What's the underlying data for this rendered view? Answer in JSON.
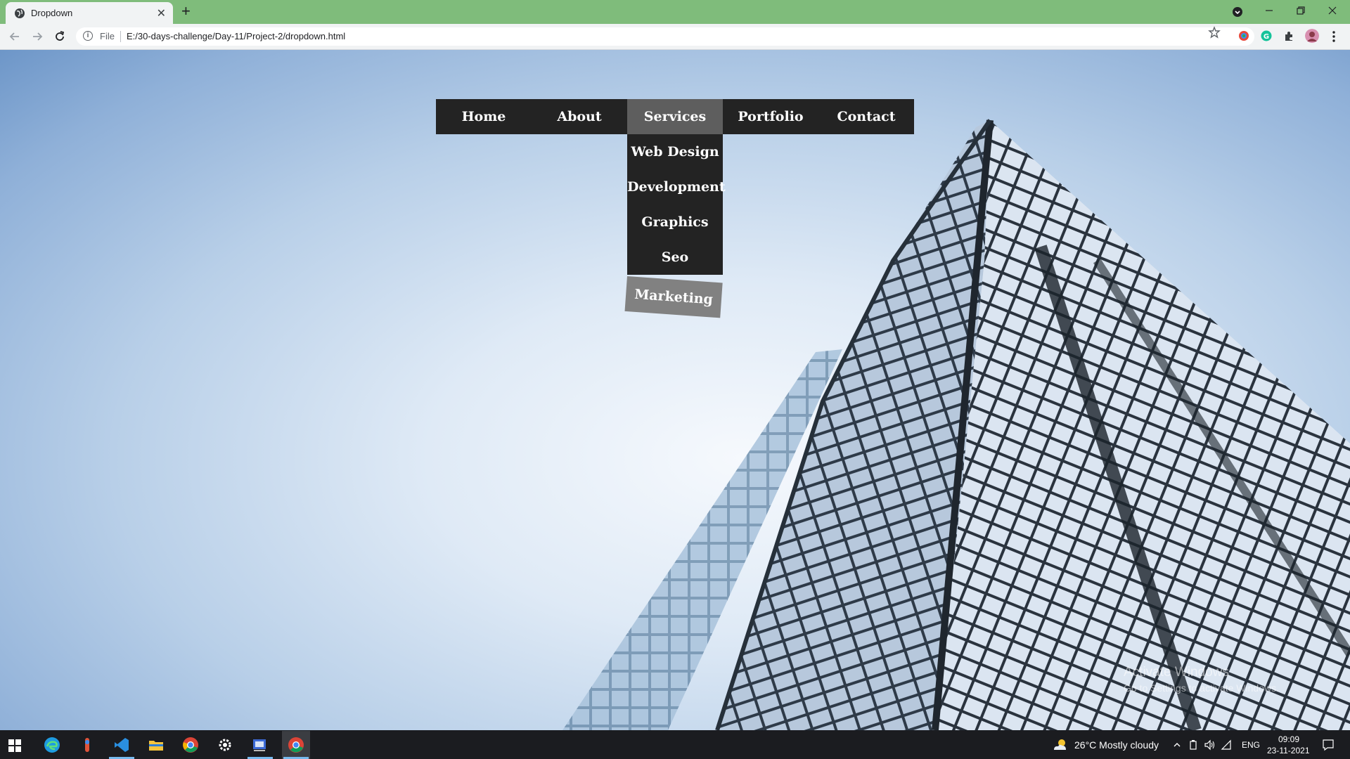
{
  "browser": {
    "tab_title": "Dropdown",
    "tab_close": "✕",
    "new_tab": "+",
    "omnibox_scheme": "File",
    "url": "E:/30-days-challenge/Day-11/Project-2/dropdown.html",
    "icons": [
      "globe-icon",
      "back-icon",
      "forward-icon",
      "reload-icon",
      "info-icon",
      "star-icon",
      "extension-icon",
      "profile-icon",
      "more-icon"
    ]
  },
  "page": {
    "menu": [
      "Home",
      "About",
      "Services",
      "Portfolio",
      "Contact"
    ],
    "active_item": "Services",
    "submenu": [
      "Web Design",
      "Development",
      "Graphics",
      "Seo"
    ],
    "submenu_tilted": "Marketing",
    "watermark_title": "Activate Windows",
    "watermark_subtitle": "Go to Settings to activate Windows."
  },
  "taskbar": {
    "weather": "26°C  Mostly cloudy",
    "language": "ENG",
    "time": "09:09",
    "date": "23-11-2021",
    "apps": [
      "start-icon",
      "edge-icon",
      "paint-icon",
      "vscode-icon",
      "file-explorer-icon",
      "chrome-icon",
      "settings-icon",
      "snipping-icon",
      "chrome-active-icon"
    ]
  },
  "colors": {
    "tabbar": "#7fbc7b",
    "menu_bg": "#232323",
    "menu_active": "#5e5e5e",
    "tilted_item": "#818181"
  }
}
